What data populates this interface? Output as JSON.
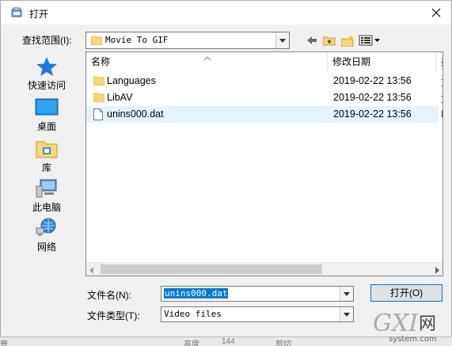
{
  "dialog": {
    "title": "打开",
    "close_glyph": "✕"
  },
  "lookin": {
    "label": "查找范围(I):",
    "value": "Movie To GIF"
  },
  "places": [
    {
      "label": "快速访问",
      "icon": "star-icon"
    },
    {
      "label": "桌面",
      "icon": "desktop-icon"
    },
    {
      "label": "库",
      "icon": "library-icon"
    },
    {
      "label": "此电脑",
      "icon": "computer-icon"
    },
    {
      "label": "网络",
      "icon": "network-icon"
    }
  ],
  "list": {
    "columns": {
      "name": "名称",
      "date": "修改日期",
      "type": "类"
    },
    "rows": [
      {
        "name": "Languages",
        "date": "2019-02-22 13:56",
        "extra": "文",
        "kind": "folder"
      },
      {
        "name": "LibAV",
        "date": "2019-02-22 13:56",
        "extra": "文",
        "kind": "folder"
      },
      {
        "name": "unins000.dat",
        "date": "2019-02-22 13:56",
        "extra": "D",
        "kind": "file"
      }
    ]
  },
  "filename": {
    "label": "文件名(N):",
    "value": "unins000.dat"
  },
  "filetype": {
    "label": "文件类型(T):",
    "value": "Video files"
  },
  "buttons": {
    "open": "打开(O)"
  },
  "background": {
    "left_fragment": "赍",
    "height_label": "高度",
    "height_value": "144",
    "crop_label": "剪切"
  },
  "watermark": {
    "brand": "GXI网",
    "site": "system.com"
  },
  "colors": {
    "accent": "#0078d7",
    "selection": "#e5f3ff",
    "folder": "#f8d775"
  }
}
